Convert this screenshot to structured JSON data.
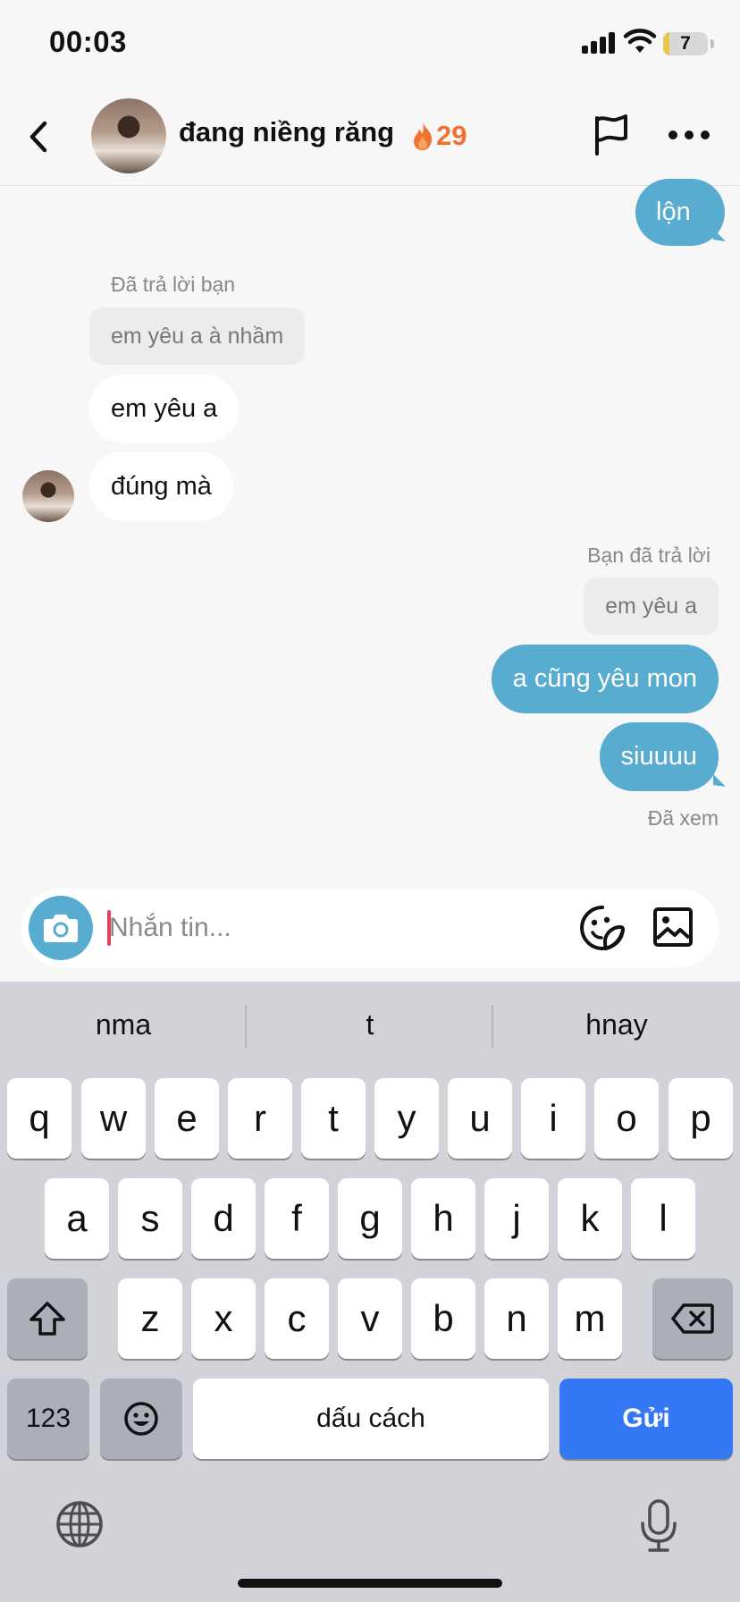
{
  "status_bar": {
    "time": "00:03",
    "battery_level": "7",
    "battery_fraction": 0.07
  },
  "header": {
    "contact_name": "đang niềng răng",
    "streak_count": "29",
    "icons": [
      "back-icon",
      "avatar",
      "fire-icon",
      "flag-icon",
      "more-icon"
    ]
  },
  "messages": {
    "m1": {
      "text": "lộn",
      "direction": "outgoing"
    },
    "reply1": {
      "label": "Đã trả lời bạn",
      "quote": "em yêu a à nhầm"
    },
    "m2": {
      "text": "em yêu a",
      "direction": "incoming"
    },
    "m3": {
      "text": "đúng mà",
      "direction": "incoming"
    },
    "reply2": {
      "label": "Bạn đã trả lời",
      "quote": "em yêu a"
    },
    "m4": {
      "text": "a cũng yêu mon",
      "direction": "outgoing"
    },
    "m5": {
      "text": "siuuuu",
      "direction": "outgoing"
    },
    "seen_status": "Đã xem"
  },
  "composer": {
    "placeholder": "Nhắn tin...",
    "value": ""
  },
  "keyboard": {
    "suggestions": [
      "nma",
      "t",
      "hnay"
    ],
    "row1": [
      "q",
      "w",
      "e",
      "r",
      "t",
      "y",
      "u",
      "i",
      "o",
      "p"
    ],
    "row2": [
      "a",
      "s",
      "d",
      "f",
      "g",
      "h",
      "j",
      "k",
      "l"
    ],
    "row3": [
      "z",
      "x",
      "c",
      "v",
      "b",
      "n",
      "m"
    ],
    "numbers_key": "123",
    "space_key": "dấu cách",
    "send_key": "Gửi"
  },
  "colors": {
    "outgoing_bubble": "#57acd0",
    "incoming_bubble": "#ffffff",
    "send_key": "#3478f6",
    "streak": "#f0722f",
    "cursor": "#e4405f"
  }
}
